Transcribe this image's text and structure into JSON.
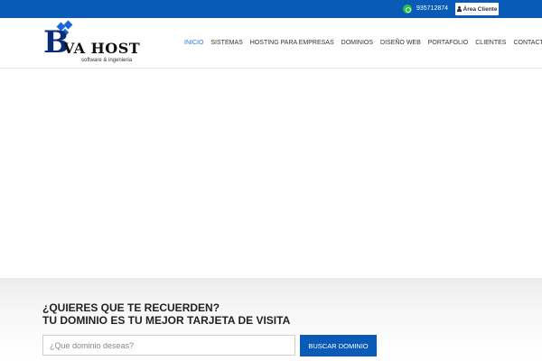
{
  "topbar": {
    "phone": "935712874",
    "client_area_label": "Área Cliente",
    "color": "#0a5ab8"
  },
  "logo": {
    "letter": "B",
    "name": "VA HOST",
    "tagline": "software & ingenieria"
  },
  "nav": {
    "items": [
      {
        "label": "INICIO",
        "active": true
      },
      {
        "label": "SISTEMAS"
      },
      {
        "label": "HOSTING PARA EMPRESAS"
      },
      {
        "label": "DOMINIOS"
      },
      {
        "label": "DISEÑO WEB"
      },
      {
        "label": "PORTAFOLIO"
      },
      {
        "label": "CLIENTES"
      },
      {
        "label": "CONTACTENOS"
      }
    ],
    "active_color": "#1a7ad8"
  },
  "domain_search": {
    "title_line1": "¿QUIERES QUE TE RECUERDEN?",
    "title_line2": "TU DOMINIO ES TU MEJOR TARJETA DE VISITA",
    "placeholder": "¿Que dominio deseas?",
    "value": "",
    "button_label": "BUSCAR DOMINIO"
  }
}
